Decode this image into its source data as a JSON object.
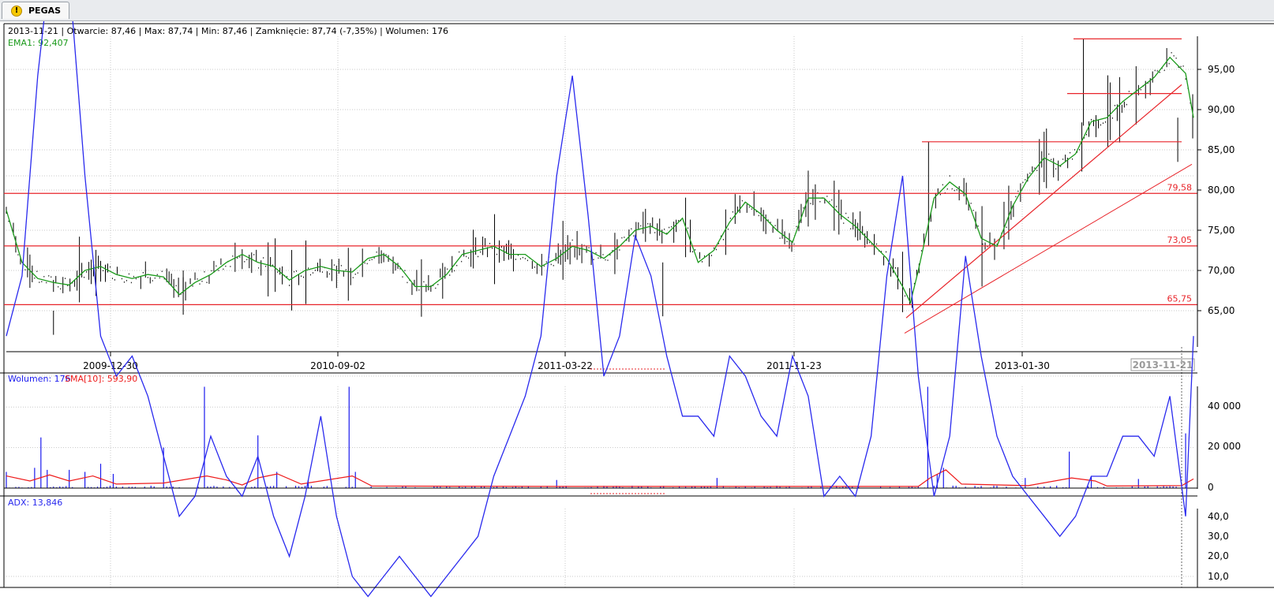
{
  "tab": {
    "label": "PEGAS",
    "icon": "warning-icon"
  },
  "colors": {
    "price": "#000000",
    "ema": "#1a9a1a",
    "lines": "#e8242a",
    "volume": "#1a1aee",
    "sma": "#ee1a1a",
    "adx": "#2a2aee",
    "grid": "#c8c8c8"
  },
  "price_panel": {
    "info": "2013-11-21 | Otwarcie: 87,46 | Max: 87,74 | Min: 87,46 | Zamknięcie: 87,74 (-7,35%)  | Wolumen: 176",
    "ema_label": "EMA1: 92,407",
    "y_ticks": [
      "65,00",
      "70,00",
      "75,00",
      "80,00",
      "85,00",
      "90,00",
      "95,00"
    ],
    "support_labels": [
      "79,58",
      "73,05",
      "65,75"
    ]
  },
  "x_labels": [
    "2009-12-30",
    "2010-09-02",
    "2011-03-22",
    "2011-11-23",
    "2013-01-30"
  ],
  "cursor_label": "2013-11-21",
  "volume_panel": {
    "label_vol": "Wolumen: 176",
    "label_sma": "SMA[10]: 593,90",
    "y_ticks": [
      "0",
      "20 000",
      "40 000"
    ]
  },
  "adx_panel": {
    "label": "ADX: 13,846",
    "y_ticks": [
      "10,0",
      "20,0",
      "30,0",
      "40,0"
    ]
  },
  "chart_data": [
    {
      "type": "line",
      "title": "PEGAS",
      "x_dates": [
        "2009-12-30",
        "2010-09-02",
        "2011-03-22",
        "2011-11-23",
        "2013-01-30",
        "2013-11-21"
      ],
      "ylim": [
        61,
        99
      ],
      "series": [
        {
          "name": "EMA1",
          "x": [
            0,
            20,
            40,
            60,
            80,
            100,
            120,
            140,
            160,
            180,
            200,
            220,
            240,
            260,
            280,
            300,
            320,
            340,
            360,
            380,
            400,
            420,
            440,
            460,
            480,
            500,
            520,
            540,
            560,
            580,
            600,
            620,
            640,
            660,
            680,
            700,
            720,
            740,
            760,
            780,
            800,
            820,
            840,
            860,
            880,
            900,
            920,
            940,
            960,
            980,
            1000,
            1020,
            1040,
            1060,
            1080,
            1100,
            1120,
            1140,
            1150,
            1160,
            1180,
            1200,
            1220,
            1240,
            1260,
            1280,
            1300,
            1320,
            1340,
            1360,
            1380,
            1400,
            1420,
            1440,
            1460,
            1480,
            1500,
            1510
          ],
          "values": [
            77.5,
            71,
            69,
            68.5,
            68.2,
            70,
            70.5,
            69.5,
            69,
            69.5,
            69.2,
            67,
            68.5,
            69.5,
            71,
            72,
            71,
            70.5,
            68.8,
            70,
            70.5,
            70,
            69.8,
            71.5,
            72,
            70.5,
            68,
            68,
            69.5,
            72,
            72.5,
            73,
            72,
            72,
            70.5,
            71.5,
            73,
            72.5,
            71.5,
            73,
            75,
            75.5,
            74.5,
            76.5,
            71,
            72.5,
            76,
            78.5,
            77,
            75,
            73.5,
            79,
            79,
            77,
            75.5,
            73.5,
            71.5,
            68,
            66,
            70,
            79,
            81,
            79.5,
            74,
            73,
            78,
            81.5,
            84,
            83,
            84.5,
            88.5,
            89,
            91,
            92.5,
            94,
            96.5,
            94.5,
            89
          ]
        },
        {
          "name": "Volume SMA[10]",
          "values": [
            593.9
          ]
        },
        {
          "name": "ADX",
          "x": [
            0,
            20,
            40,
            60,
            80,
            100,
            120,
            140,
            160,
            180,
            200,
            220,
            240,
            260,
            280,
            300,
            320,
            340,
            360,
            380,
            400,
            420,
            440,
            460,
            480,
            500,
            520,
            540,
            560,
            580,
            600,
            620,
            640,
            660,
            680,
            700,
            720,
            740,
            760,
            780,
            800,
            820,
            840,
            860,
            880,
            900,
            920,
            940,
            960,
            980,
            1000,
            1020,
            1040,
            1060,
            1080,
            1100,
            1120,
            1140,
            1160,
            1180,
            1200,
            1220,
            1240,
            1260,
            1280,
            1300,
            1320,
            1340,
            1360,
            1380,
            1400,
            1420,
            1440,
            1460,
            1480,
            1500,
            1510
          ],
          "values": [
            22,
            25,
            35,
            42,
            40,
            30,
            22,
            20,
            21,
            19,
            16,
            13,
            14,
            17,
            15,
            14,
            16,
            13,
            11,
            14,
            18,
            13,
            10,
            9,
            10,
            11,
            10,
            9,
            10,
            11,
            12,
            15,
            17,
            19,
            22,
            30,
            35,
            28,
            20,
            22,
            27,
            25,
            21,
            18,
            18,
            17,
            21,
            20,
            18,
            17,
            21,
            19,
            14,
            15,
            14,
            17,
            25,
            30,
            20,
            14,
            17,
            26,
            21,
            17,
            15,
            14,
            13,
            12,
            13,
            15,
            15,
            17,
            17,
            16,
            19,
            13,
            22
          ]
        }
      ]
    }
  ]
}
